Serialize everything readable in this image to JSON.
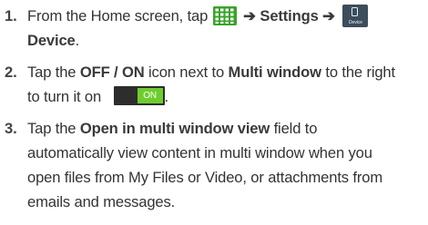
{
  "steps": [
    {
      "number": "1.",
      "line1_prefix": "From the Home screen, tap",
      "arrow1": "➔",
      "settings_label": "Settings",
      "arrow2": "➔",
      "device_icon_caption": "Device",
      "device_label": "Device",
      "period": "."
    },
    {
      "number": "2.",
      "text_a": "Tap the ",
      "off_on_label": "OFF / ON",
      "text_b": " icon next to ",
      "multi_window_label": "Multi window",
      "text_c": " to the right",
      "text_d": "to turn it on",
      "toggle_on_text": "ON",
      "period": "."
    },
    {
      "number": "3.",
      "text_a": "Tap the ",
      "field_label": "Open in multi window view",
      "text_b": " field to",
      "line2": "automatically view content in multi window when you",
      "line3": "open files from My Files or Video, or attachments from",
      "line4": "emails and messages."
    }
  ],
  "colors": {
    "apps_icon_green": "#3aa32a",
    "device_icon_bg": "#3c4d5c",
    "toggle_track": "#2d2d2d",
    "toggle_on": "#6dcd2e"
  }
}
